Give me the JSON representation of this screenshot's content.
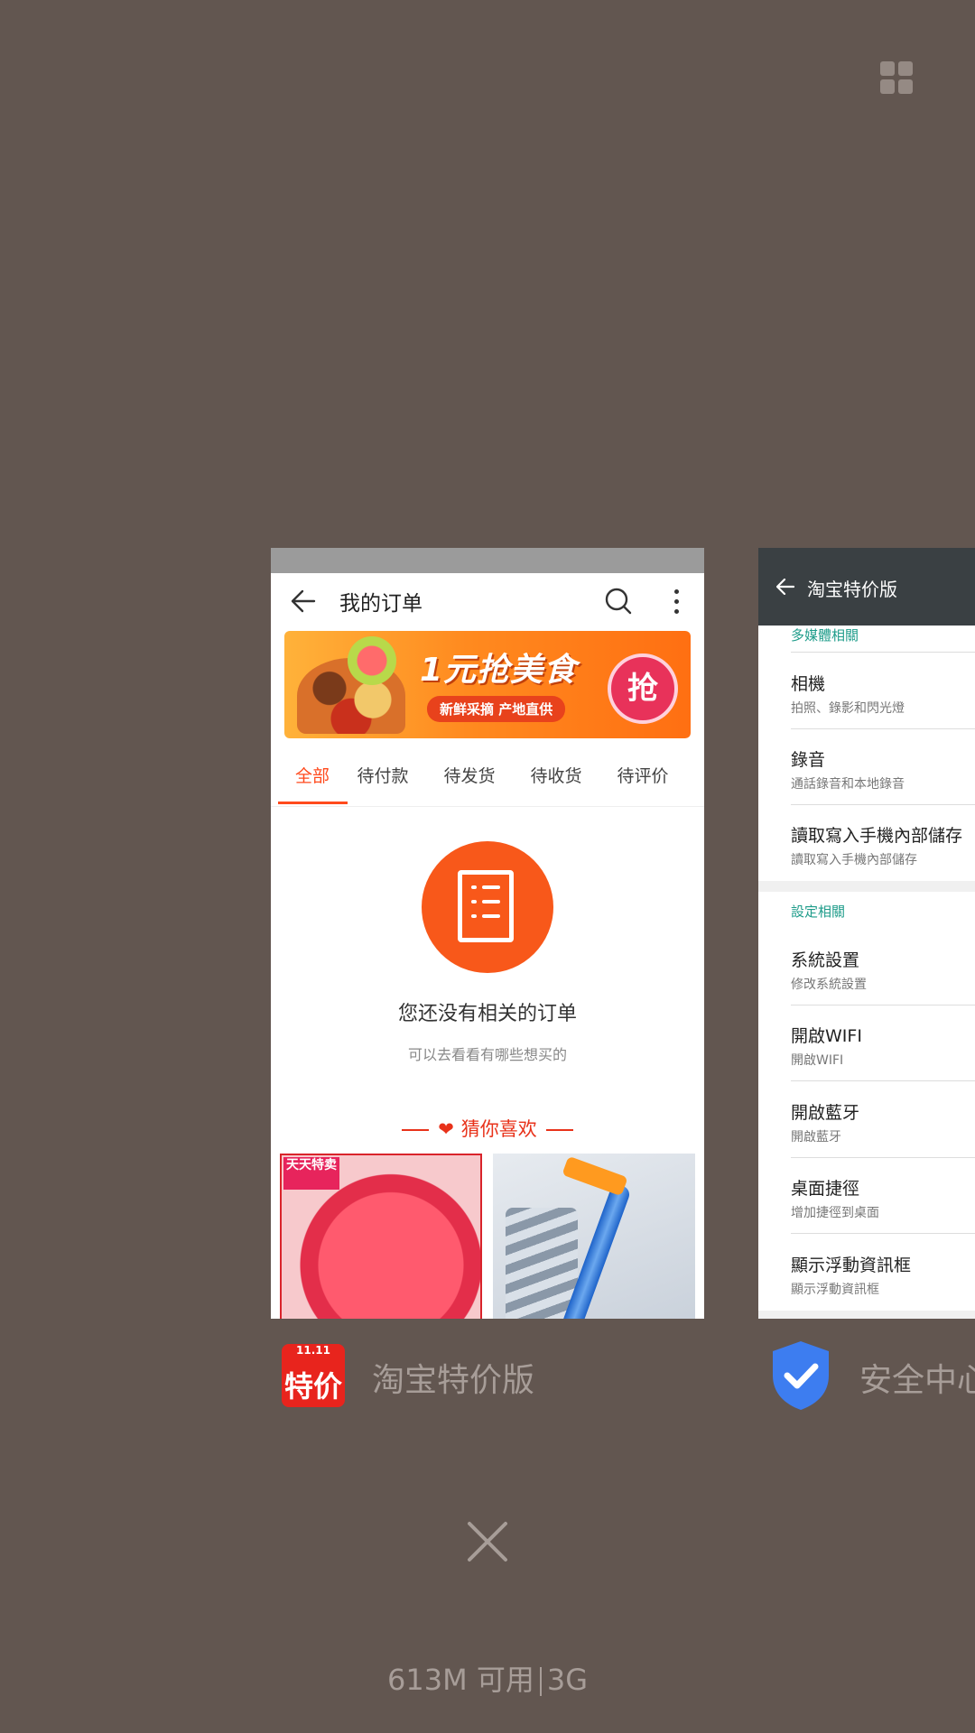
{
  "recents_header": {
    "grid_icon": "grid-icon"
  },
  "taobao_card": {
    "header": {
      "title": "我的订单",
      "back_icon": "arrow-left-icon",
      "search_icon": "search-icon",
      "more_icon": "more-vertical-icon"
    },
    "banner": {
      "main_text": "1元抢美食",
      "sub_text": "新鲜采摘 产地直供",
      "button_text": "抢"
    },
    "tabs": [
      {
        "label": "全部",
        "active": true
      },
      {
        "label": "待付款",
        "active": false
      },
      {
        "label": "待发货",
        "active": false
      },
      {
        "label": "待收货",
        "active": false
      },
      {
        "label": "待评价",
        "active": false
      }
    ],
    "empty_state": {
      "title": "您还没有相关的订单",
      "subtitle": "可以去看看有哪些想买的",
      "icon": "document-list-icon"
    },
    "recommend": {
      "title": "猜你喜欢",
      "icon": "heart-icon"
    },
    "products": [
      {
        "name": "apple",
        "tag": "天天特卖"
      },
      {
        "name": "razor"
      }
    ],
    "accent_color": "#ff4a1d"
  },
  "security_card": {
    "header": {
      "title": "淘宝特价版",
      "back_icon": "arrow-left-icon"
    },
    "sections": [
      {
        "title": "多媒體相關",
        "items": [
          {
            "title": "相機",
            "subtitle": "拍照、錄影和閃光燈"
          },
          {
            "title": "錄音",
            "subtitle": "通話錄音和本地錄音"
          },
          {
            "title": "讀取寫入手機內部儲存",
            "subtitle": "讀取寫入手機內部儲存"
          }
        ]
      },
      {
        "title": "設定相關",
        "items": [
          {
            "title": "系統設置",
            "subtitle": "修改系統設置"
          },
          {
            "title": "開啟WIFI",
            "subtitle": "開啟WIFI"
          },
          {
            "title": "開啟藍牙",
            "subtitle": "開啟藍牙"
          },
          {
            "title": "桌面捷徑",
            "subtitle": "增加捷徑到桌面"
          },
          {
            "title": "顯示浮動資訊框",
            "subtitle": "顯示浮動資訊框"
          }
        ]
      }
    ],
    "accent_color": "#1e9c8a"
  },
  "app_labels": {
    "taobao": {
      "name": "淘宝特价版",
      "icon_top": "11.11",
      "icon_main": "特价"
    },
    "security": {
      "name": "安全中心",
      "icon": "shield-check-icon"
    }
  },
  "close_all": {
    "icon": "close-icon"
  },
  "memory": {
    "available": "613M 可用",
    "total": "3G"
  }
}
